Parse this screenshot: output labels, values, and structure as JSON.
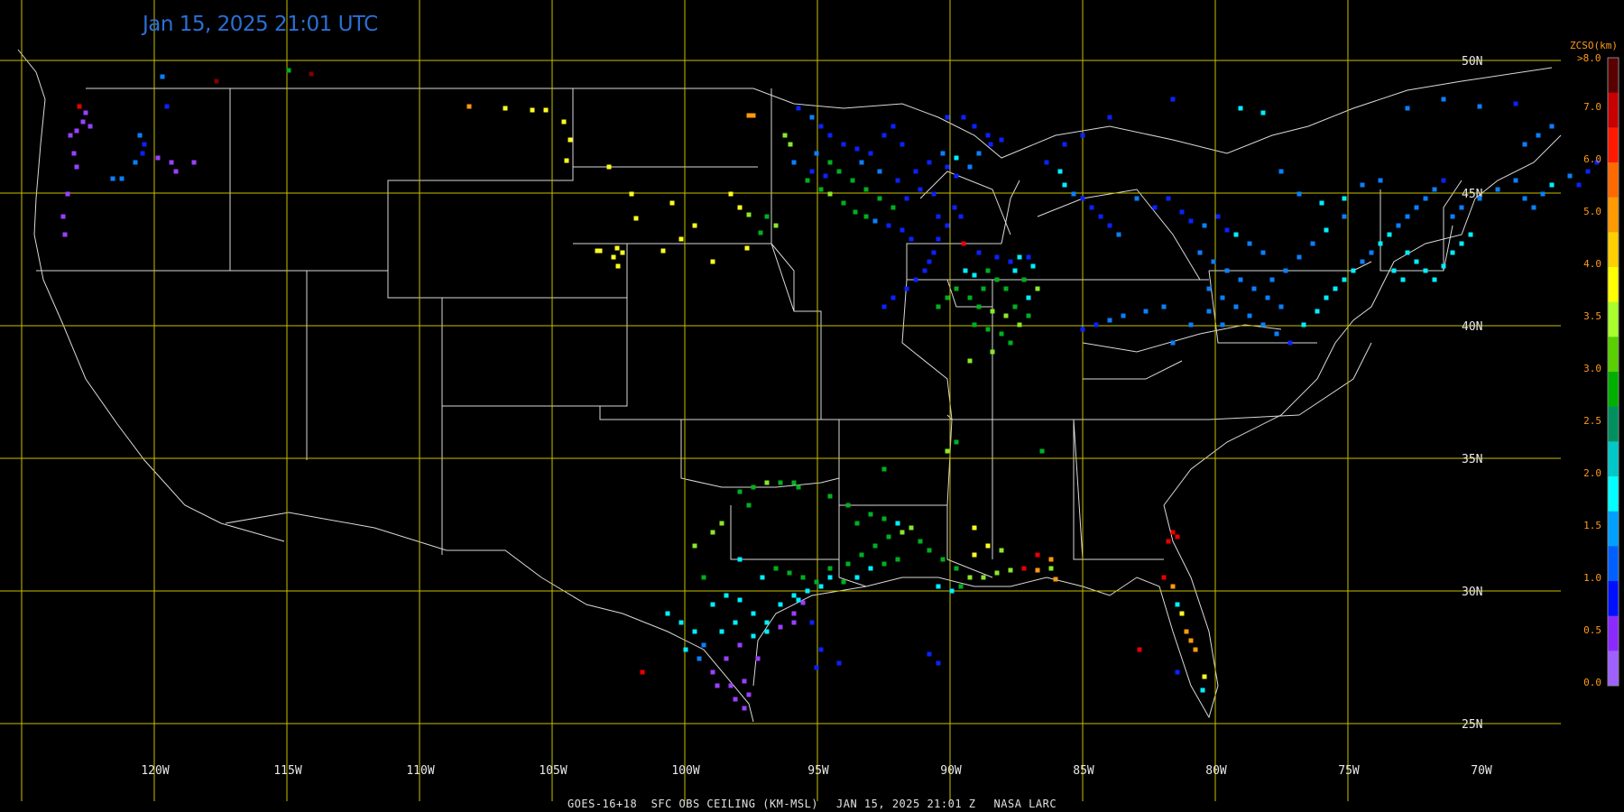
{
  "title": "Jan 15, 2025 21:01 UTC",
  "footer": {
    "product": "GOES-16+18  SFC OBS CEILING (KM-MSL)",
    "datetime": "JAN 15, 2025 21:01 Z",
    "source": "NASA LARC"
  },
  "longitude_labels": [
    "120W",
    "115W",
    "110W",
    "105W",
    "100W",
    "95W",
    "90W",
    "85W",
    "80W",
    "75W",
    "70W"
  ],
  "latitude_labels": [
    "50N",
    "45N",
    "40N",
    "35N",
    "30N",
    "25N"
  ],
  "legend": {
    "title": "ZCSO(km)",
    "max_label": ">8.0",
    "tick_labels": [
      "7.0",
      "6.0",
      "5.0",
      "4.0",
      "3.5",
      "3.0",
      "2.5",
      "2.0",
      "1.5",
      "1.0",
      "0.5",
      "0.0"
    ],
    "colors": [
      "#5a0000",
      "#c80000",
      "#ff1a00",
      "#ff6a00",
      "#ff9a00",
      "#ffd000",
      "#ffff00",
      "#a8ff2a",
      "#5ad000",
      "#00b000",
      "#009060",
      "#00c8c8",
      "#00ffff",
      "#00a0ff",
      "#0060ff",
      "#0010ff",
      "#8a2aff",
      "#a060ff"
    ]
  },
  "colors": {
    "background": "#000000",
    "grid": "#c8c000",
    "borders": "#ffffff",
    "title": "#2a6fd6"
  }
}
